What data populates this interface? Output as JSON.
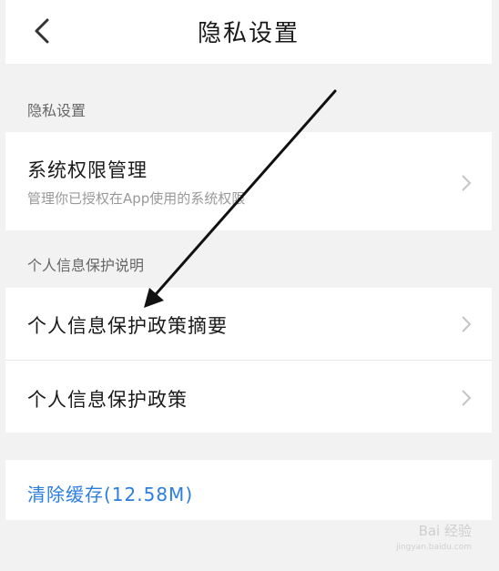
{
  "header": {
    "title": "隐私设置"
  },
  "sections": {
    "privacy_label": "隐私设置",
    "personal_info_label": "个人信息保护说明"
  },
  "rows": {
    "permissions": {
      "title": "系统权限管理",
      "subtitle": "管理你已授权在App使用的系统权限"
    },
    "policy_summary": {
      "title": "个人信息保护政策摘要"
    },
    "policy": {
      "title": "个人信息保护政策"
    },
    "clear_cache": {
      "label": "清除缓存(12.58M)"
    }
  },
  "watermark": {
    "text": "Bai 经验",
    "sub": "jingyan.baidu.com"
  },
  "colors": {
    "accent": "#2b7de0",
    "background": "#f2f2f2",
    "surface": "#ffffff"
  }
}
